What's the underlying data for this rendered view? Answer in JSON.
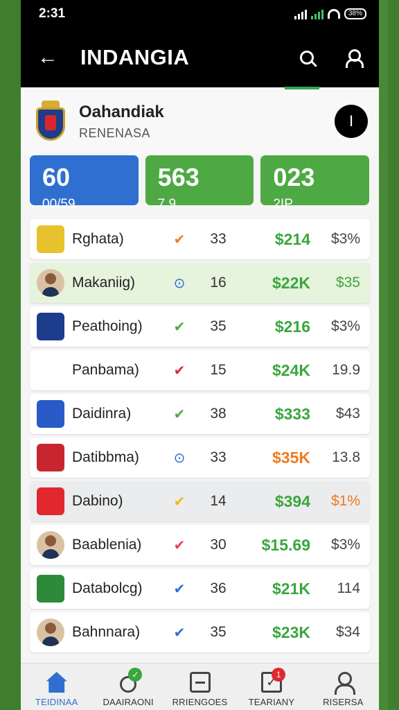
{
  "status_bar": {
    "time": "2:31",
    "battery": "38%"
  },
  "app_bar": {
    "back_glyph": "←",
    "title": "INDANGIA",
    "icons": [
      "search-icon",
      "user-icon"
    ]
  },
  "profile": {
    "name": "Oahandiak",
    "subtitle": "RENENASA",
    "more_glyph": "I"
  },
  "stats": [
    {
      "big": "60",
      "small": "00/59",
      "color": "#2f6fd0"
    },
    {
      "big": "563",
      "small": "7 9",
      "color": "#4ea944"
    },
    {
      "big": "023",
      "small": "2IP",
      "color": "#4ea944"
    }
  ],
  "rows": [
    {
      "name": "Rghata)",
      "mark": "✔",
      "mark_color": "#f07a1e",
      "count": "33",
      "value": "$214",
      "value_color": "#3aa63f",
      "pct": "$3%",
      "pct_color": "#444",
      "logo_bg": "#e8c22c",
      "highlight": ""
    },
    {
      "name": "Makaniig)",
      "mark": "⊙",
      "mark_color": "#2f6fd0",
      "count": "16",
      "value": "$22K",
      "value_color": "#3aa63f",
      "pct": "$35",
      "pct_color": "#3aa63f",
      "logo_bg": "#d9c2a4",
      "highlight": "green",
      "avatar": true
    },
    {
      "name": "Peathoing)",
      "mark": "✔",
      "mark_color": "#4ea944",
      "count": "35",
      "value": "$216",
      "value_color": "#3aa63f",
      "pct": "$3%",
      "pct_color": "#444",
      "logo_bg": "#1e3c8c",
      "highlight": ""
    },
    {
      "name": "Panbama)",
      "mark": "✔",
      "mark_color": "#e0282e",
      "count": "15",
      "value": "$24K",
      "value_color": "#3aa63f",
      "pct": "19.9",
      "pct_color": "#444",
      "logo_bg": "#ffffff",
      "highlight": ""
    },
    {
      "name": "Daidinra)",
      "mark": "✔",
      "mark_color": "#4ea944",
      "count": "38",
      "value": "$333",
      "value_color": "#3aa63f",
      "pct": "$43",
      "pct_color": "#444",
      "logo_bg": "#2a5ac8",
      "highlight": ""
    },
    {
      "name": "Datibbma)",
      "mark": "⊙",
      "mark_color": "#2f6fd0",
      "count": "33",
      "value": "$35K",
      "value_color": "#f07a1e",
      "pct": "13.8",
      "pct_color": "#444",
      "logo_bg": "#c8262e",
      "highlight": ""
    },
    {
      "name": "Dabino)",
      "mark": "✔",
      "mark_color": "#f2b90c",
      "count": "14",
      "value": "$394",
      "value_color": "#3aa63f",
      "pct": "$1%",
      "pct_color": "#f07a1e",
      "logo_bg": "#e0282e",
      "highlight": "grey"
    },
    {
      "name": "Baablenia)",
      "mark": "✔",
      "mark_color": "#e83e5a",
      "count": "30",
      "value": "$15.69",
      "value_color": "#3aa63f",
      "pct": "$3%",
      "pct_color": "#444",
      "logo_bg": "#d9c2a4",
      "highlight": "",
      "avatar": true
    },
    {
      "name": "Databolcg)",
      "mark": "✔",
      "mark_color": "#2f6fd0",
      "count": "36",
      "value": "$21K",
      "value_color": "#3aa63f",
      "pct": "114",
      "pct_color": "#444",
      "logo_bg": "#2d8a3a",
      "highlight": ""
    },
    {
      "name": "Bahnnara)",
      "mark": "✔",
      "mark_color": "#2f6fd0",
      "count": "35",
      "value": "$23K",
      "value_color": "#3aa63f",
      "pct": "$34",
      "pct_color": "#444",
      "logo_bg": "#d9c2a4",
      "highlight": "",
      "avatar": true
    }
  ],
  "bottom_nav": [
    {
      "label": "TEIDINAA",
      "icon": "home-icon",
      "active": true,
      "badge": ""
    },
    {
      "label": "DAAIRAONI",
      "icon": "search-icon",
      "active": false,
      "badge": "✓",
      "badge_color": "green"
    },
    {
      "label": "RRIENGOES",
      "icon": "document-icon",
      "active": false,
      "badge": ""
    },
    {
      "label": "TEARIANY",
      "icon": "checkbox-icon",
      "active": false,
      "badge": "1",
      "badge_color": "red"
    },
    {
      "label": "RISERSA",
      "icon": "person-icon",
      "active": false,
      "badge": ""
    }
  ]
}
